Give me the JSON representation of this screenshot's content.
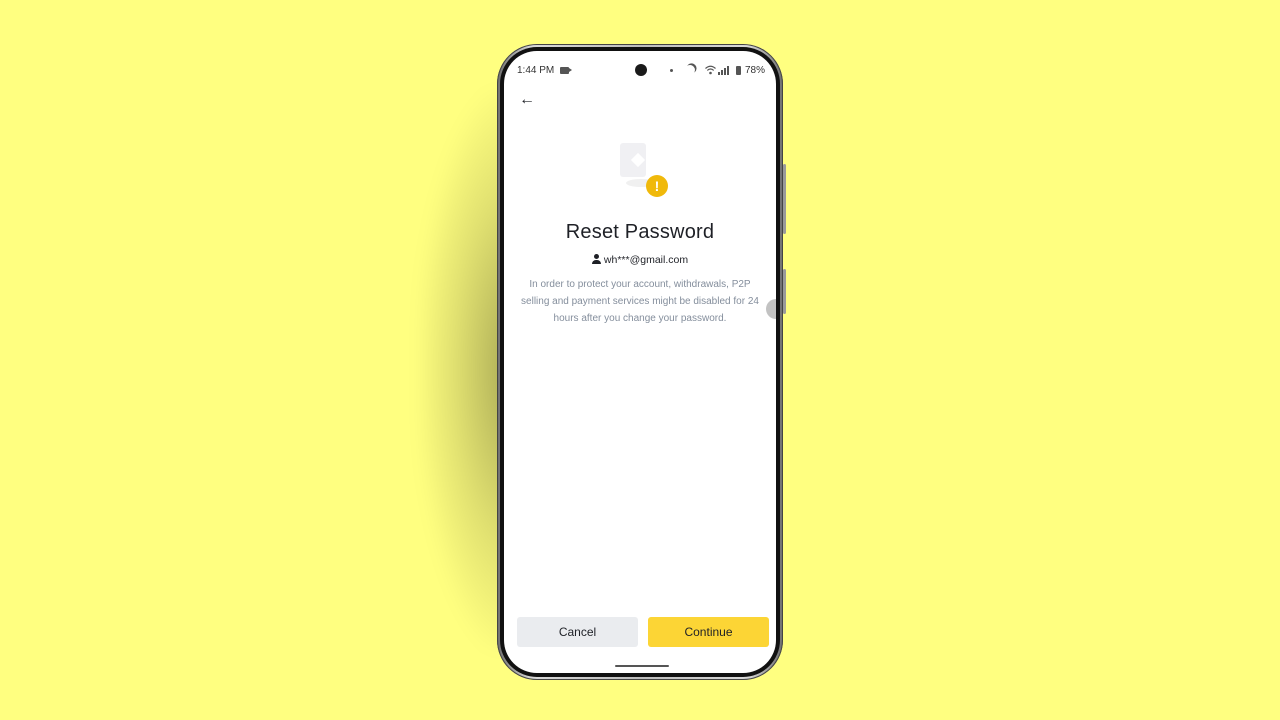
{
  "status_bar": {
    "time": "1:44 PM",
    "battery": "78%",
    "wifi_icon": "wifi-icon",
    "signal_icon": "signal-icon",
    "moon_icon": "moon-icon",
    "camera_icon": "video-camera-icon"
  },
  "header": {
    "back_icon": "arrow-left-icon",
    "back_glyph": "←"
  },
  "hero": {
    "icon": "warning-icon",
    "warning_glyph": "!"
  },
  "content": {
    "title": "Reset Password",
    "account": "wh***@gmail.com",
    "info": "In order to protect your account, withdrawals, P2P selling and payment services might be disabled for 24 hours after you change your password."
  },
  "actions": {
    "cancel_label": "Cancel",
    "continue_label": "Continue"
  },
  "colors": {
    "background": "#ffff80",
    "accent": "#fcd535",
    "warning": "#f0b90b",
    "secondary_button": "#eaecef",
    "text_primary": "#1e2026",
    "text_secondary": "#848e9c"
  }
}
